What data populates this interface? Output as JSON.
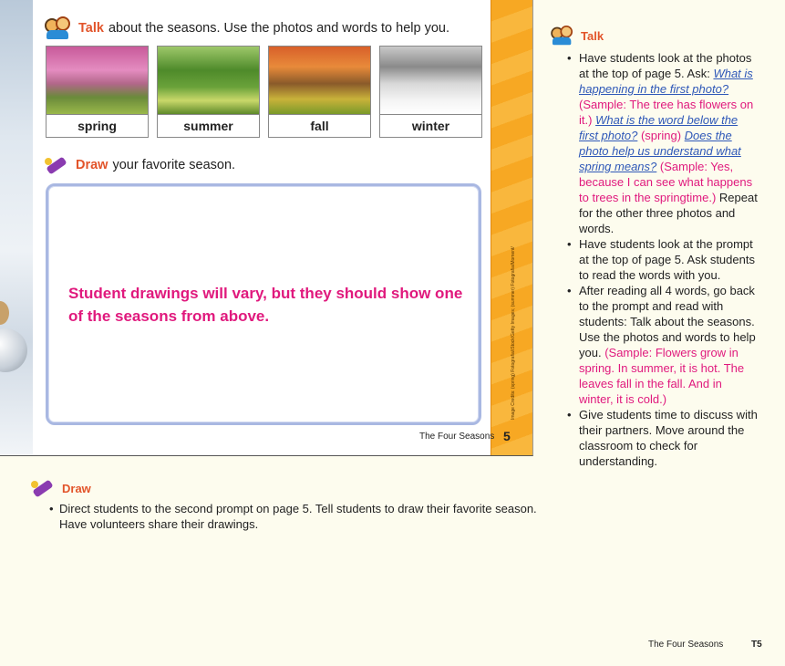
{
  "student_page": {
    "talk_prompt": {
      "keyword": "Talk",
      "text": "about the seasons. Use the photos and words to help you."
    },
    "photos": [
      {
        "label": "spring"
      },
      {
        "label": "summer"
      },
      {
        "label": "fall"
      },
      {
        "label": "winter"
      }
    ],
    "draw_prompt": {
      "keyword": "Draw",
      "text": "your favorite season."
    },
    "draw_answer": "Student drawings will vary, but they should show one of the seasons from above.",
    "footer": "The Four Seasons",
    "page_number": "5",
    "credits": "Image Credits: (spring) Fotografia/iStock/Getty Images; (summer) Fotografia/Moment/Getty Images; (fall) Fotografia/Moment/Getty Images; (winter) Fotografia/Moment/Getty Images"
  },
  "teacher_notes": {
    "talk": {
      "heading": "Talk",
      "bullets": [
        {
          "intro": "Have students look at the photos at the top of page 5. Ask:",
          "q1": "What is happening in the first photo?",
          "a1": "(Sample: The tree has flowers on it.)",
          "q2": "What is the word below the first photo?",
          "a2": "(spring)",
          "q3": "Does the photo help us understand what spring means?",
          "a3": "(Sample: Yes, because I can see what happens to trees in the springtime.)",
          "outro": "Repeat for the other three photos and words."
        },
        {
          "text": "Have students look at the prompt at the top of page 5. Ask students to read the words with you."
        },
        {
          "text": "After reading all 4 words, go back to the prompt and read with students: Talk about the seasons. Use the photos and words to help you.",
          "sample": "(Sample: Flowers grow in spring. In summer, it is hot. The leaves fall in the fall. And in winter, it is cold.)"
        },
        {
          "text": "Give students time to discuss with their partners. Move around the classroom to check for understanding."
        }
      ]
    },
    "draw": {
      "heading": "Draw",
      "bullets": [
        {
          "text": "Direct students to the second prompt on page 5. Tell students to draw their favorite season. Have volunteers share their drawings."
        }
      ]
    }
  },
  "footer": {
    "title": "The Four Seasons",
    "page": "T5"
  },
  "colors": {
    "accent_orange": "#e2542a",
    "magenta": "#e0197d",
    "question_blue": "#2f58b8",
    "band_orange": "#f7a823"
  }
}
